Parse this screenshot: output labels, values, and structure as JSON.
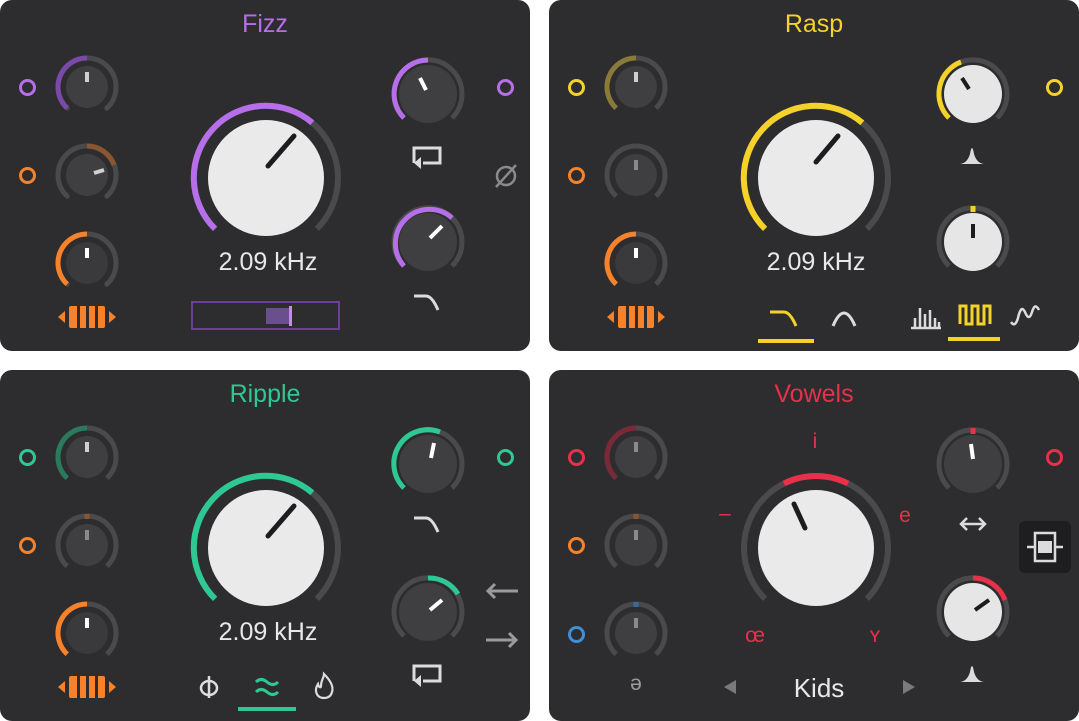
{
  "colors": {
    "panel_bg": "#2d2d2f",
    "track": "#4a4a4c",
    "fizz": "#b66fe8",
    "rasp": "#f4d22a",
    "ripple": "#2ec993",
    "vowels": "#e8304a",
    "orange": "#f7822a",
    "blue": "#3e8ed8"
  },
  "fizz": {
    "title": "Fizz",
    "readout": "2.09 kHz",
    "icons": [
      "feedback-loop-icon",
      "phase-invert-icon",
      "lowpass-slope-icon",
      "keyboard-tracking-icon"
    ],
    "slider_value": 0.65
  },
  "rasp": {
    "title": "Rasp",
    "readout": "2.09 kHz",
    "icons": [
      "resonance-peak-icon",
      "lowpass-slope-icon",
      "bandpass-icon",
      "comb-icon",
      "square-wave-icon",
      "sine-wave-icon",
      "keyboard-tracking-icon"
    ],
    "selected_filter": "lowpass",
    "selected_wave": "square"
  },
  "ripple": {
    "title": "Ripple",
    "readout": "2.09 kHz",
    "icons": [
      "lowpass-slope-icon",
      "feedback-loop-icon",
      "arrow-left-icon",
      "arrow-right-icon",
      "phi-icon",
      "approx-wave-icon",
      "flame-icon",
      "keyboard-tracking-icon"
    ],
    "selected_mode": "approx"
  },
  "vowels": {
    "title": "Vowels",
    "vowel_labels": {
      "top": "i",
      "right": "e",
      "left": "–",
      "bottom_left": "œ",
      "bottom_right": "ʏ",
      "schwa": "ə"
    },
    "preset": "Kids",
    "icons": [
      "swap-horizontal-icon",
      "resonance-peak-icon",
      "chevron-left-icon",
      "chevron-right-icon",
      "stack-icon"
    ]
  }
}
